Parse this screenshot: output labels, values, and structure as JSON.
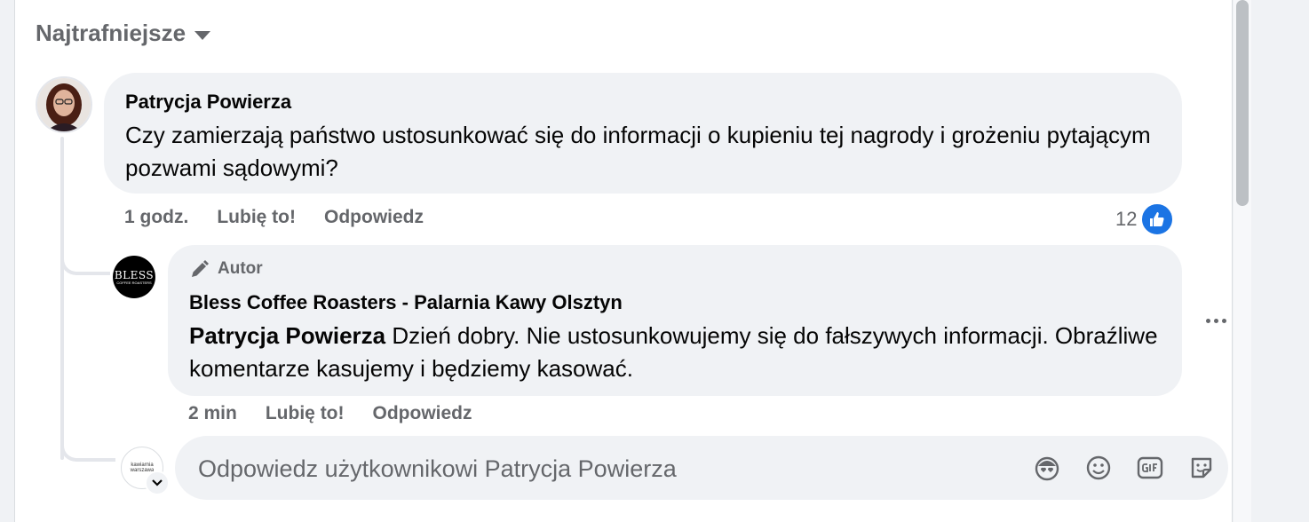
{
  "sort": {
    "label": "Najtrafniejsze",
    "icon": "caret-down-icon"
  },
  "comment": {
    "author": "Patrycja Powierza",
    "text": "Czy zamierzają państwo ustosunkować się do informacji o kupieniu tej nagrody i grożeniu pytającym pozwami sądowymi?",
    "time": "1 godz.",
    "like_label": "Lubię to!",
    "reply_label": "Odpowiedz",
    "reaction_count": "12",
    "reaction_icon": "like-icon"
  },
  "reply": {
    "badge_label": "Autor",
    "badge_icon": "pencil-icon",
    "author": "Bless Coffee Roasters - Palarnia Kawy Olsztyn",
    "mention": "Patrycja Powierza",
    "text": " Dzień dobry. Nie ustosunkowujemy się do fałszywych informacji. Obraźliwe komentarze kasujemy i będziemy kasować.",
    "time": "2 min",
    "like_label": "Lubię to!",
    "reply_label": "Odpowiedz",
    "avatar_brand": "BLESS",
    "avatar_sub": "COFFEE ROASTERS",
    "more_icon": "more-options-icon"
  },
  "composer": {
    "placeholder": "Odpowiedz użytkownikowi Patrycja Powierza",
    "avatar_text_1": "kawiarnia",
    "avatar_text_2": "warszawa",
    "icons": [
      "avatar-sticker-icon",
      "emoji-icon",
      "gif-icon",
      "sticker-icon"
    ]
  },
  "colors": {
    "like_blue": "#1b74e4",
    "bubble": "#f0f2f5",
    "secondary_text": "#65676b"
  }
}
